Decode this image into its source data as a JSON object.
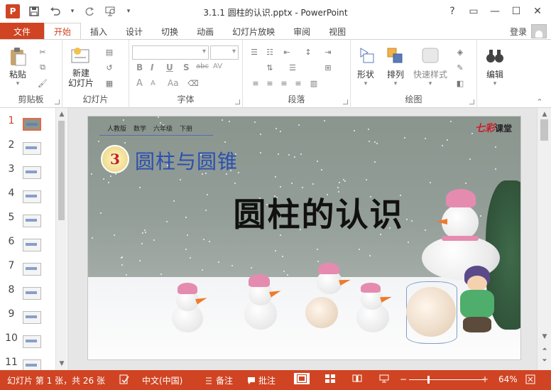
{
  "titlebar": {
    "app_logo": "P",
    "title": "3.1.1 圆柱的认识.pptx - PowerPoint",
    "help": "?",
    "buttons": {
      "ribbon_display": "▭",
      "minimize": "—",
      "maximize": "☐",
      "close": "✕"
    }
  },
  "tabs": {
    "file": "文件",
    "items": [
      "开始",
      "插入",
      "设计",
      "切换",
      "动画",
      "幻灯片放映",
      "审阅",
      "视图"
    ],
    "active": "开始",
    "login": "登录"
  },
  "ribbon": {
    "clipboard": {
      "label": "剪贴板",
      "paste": "粘贴"
    },
    "slides": {
      "label": "幻灯片",
      "new_slide": "新建\n幻灯片"
    },
    "font": {
      "label": "字体",
      "bold": "B",
      "italic": "I",
      "underline": "U",
      "shadow": "S",
      "strike": "abc",
      "spacing": "AV",
      "grow": "A",
      "shrink": "A",
      "color": "Aa",
      "fontcolor": "A"
    },
    "paragraph": {
      "label": "段落"
    },
    "drawing": {
      "label": "绘图",
      "shapes": "形状",
      "arrange": "排列",
      "quick_styles": "快速样式"
    },
    "editing": {
      "label": "编辑",
      "edit": "编辑"
    }
  },
  "thumbnails": {
    "active_index": 0,
    "numbers": [
      "1",
      "2",
      "3",
      "4",
      "5",
      "6",
      "7",
      "8",
      "9",
      "10",
      "11"
    ]
  },
  "slide": {
    "header_items": [
      "人教版",
      "数学",
      "六年级",
      "下册"
    ],
    "brand": "七彩",
    "brand_suffix": "课堂",
    "chapter_number": "3",
    "chapter_title": "圆柱与圆锥",
    "main_title": "圆柱的认识"
  },
  "statusbar": {
    "slide_info": "幻灯片 第 1 张，共 26 张",
    "language": "中文(中国)",
    "notes": "备注",
    "comments": "批注",
    "zoom": "64%",
    "zoom_minus": "−",
    "zoom_plus": "+"
  },
  "colors": {
    "accent": "#d04423",
    "title_blue": "#2a4fb0",
    "brand_red": "#c8202a"
  }
}
